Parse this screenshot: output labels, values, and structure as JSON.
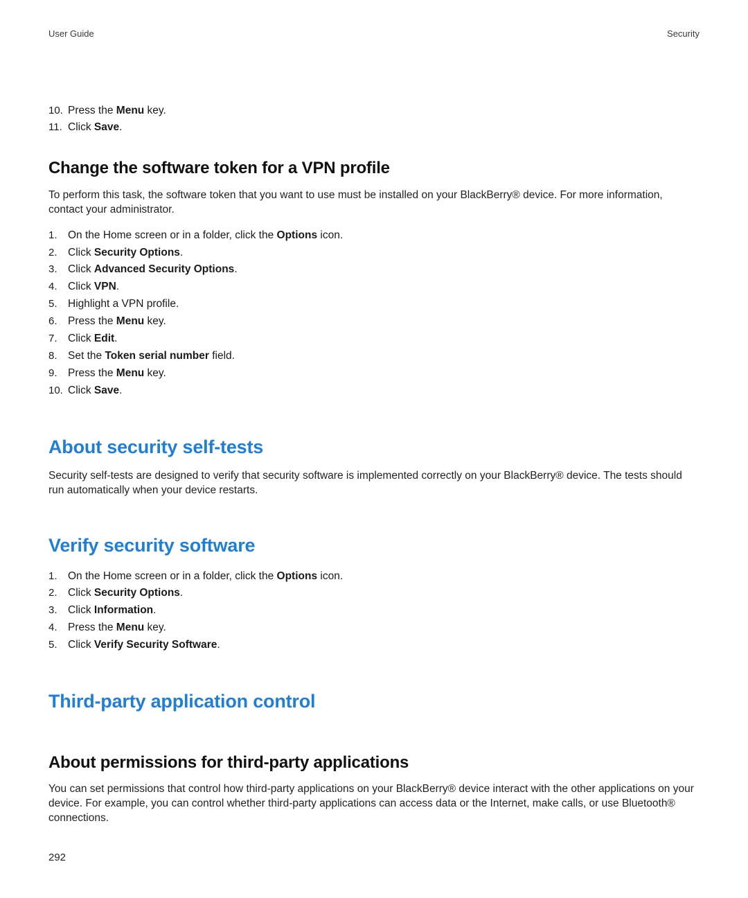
{
  "header": {
    "left": "User Guide",
    "right": "Security"
  },
  "topList": [
    {
      "num": "10.",
      "parts": [
        "Press the ",
        "Menu",
        " key."
      ]
    },
    {
      "num": "11.",
      "parts": [
        "Click ",
        "Save",
        "."
      ]
    }
  ],
  "sectionA": {
    "title": "Change the software token for a VPN profile",
    "intro": "To perform this task, the software token that you want to use must be installed on your BlackBerry® device. For more information, contact your administrator.",
    "steps": [
      {
        "num": "1.",
        "parts": [
          "On the Home screen or in a folder, click the ",
          "Options",
          " icon."
        ]
      },
      {
        "num": "2.",
        "parts": [
          "Click ",
          "Security Options",
          "."
        ]
      },
      {
        "num": "3.",
        "parts": [
          "Click ",
          "Advanced Security Options",
          "."
        ]
      },
      {
        "num": "4.",
        "parts": [
          "Click ",
          "VPN",
          "."
        ]
      },
      {
        "num": "5.",
        "parts": [
          "Highlight a VPN profile."
        ]
      },
      {
        "num": "6.",
        "parts": [
          "Press the ",
          "Menu",
          " key."
        ]
      },
      {
        "num": "7.",
        "parts": [
          "Click ",
          "Edit",
          "."
        ]
      },
      {
        "num": "8.",
        "parts": [
          "Set the ",
          "Token serial number",
          " field."
        ]
      },
      {
        "num": "9.",
        "parts": [
          "Press the ",
          "Menu",
          " key."
        ]
      },
      {
        "num": "10.",
        "parts": [
          "Click ",
          "Save",
          "."
        ]
      }
    ]
  },
  "sectionB": {
    "title": "About security self-tests",
    "body": "Security self-tests are designed to verify that security software is implemented correctly on your BlackBerry® device. The tests should run automatically when your device restarts."
  },
  "sectionC": {
    "title": "Verify security software",
    "steps": [
      {
        "num": "1.",
        "parts": [
          "On the Home screen or in a folder, click the ",
          "Options",
          " icon."
        ]
      },
      {
        "num": "2.",
        "parts": [
          "Click ",
          "Security Options",
          "."
        ]
      },
      {
        "num": "3.",
        "parts": [
          "Click ",
          "Information",
          "."
        ]
      },
      {
        "num": "4.",
        "parts": [
          "Press the ",
          "Menu",
          " key."
        ]
      },
      {
        "num": "5.",
        "parts": [
          "Click ",
          "Verify Security Software",
          "."
        ]
      }
    ]
  },
  "sectionD": {
    "title": "Third-party application control",
    "subTitle": "About permissions for third-party applications",
    "body": "You can set permissions that control how third-party applications on your BlackBerry® device interact with the other applications on your device. For example, you can control whether third-party applications can access data or the Internet, make calls, or use Bluetooth® connections."
  },
  "pageNumber": "292"
}
